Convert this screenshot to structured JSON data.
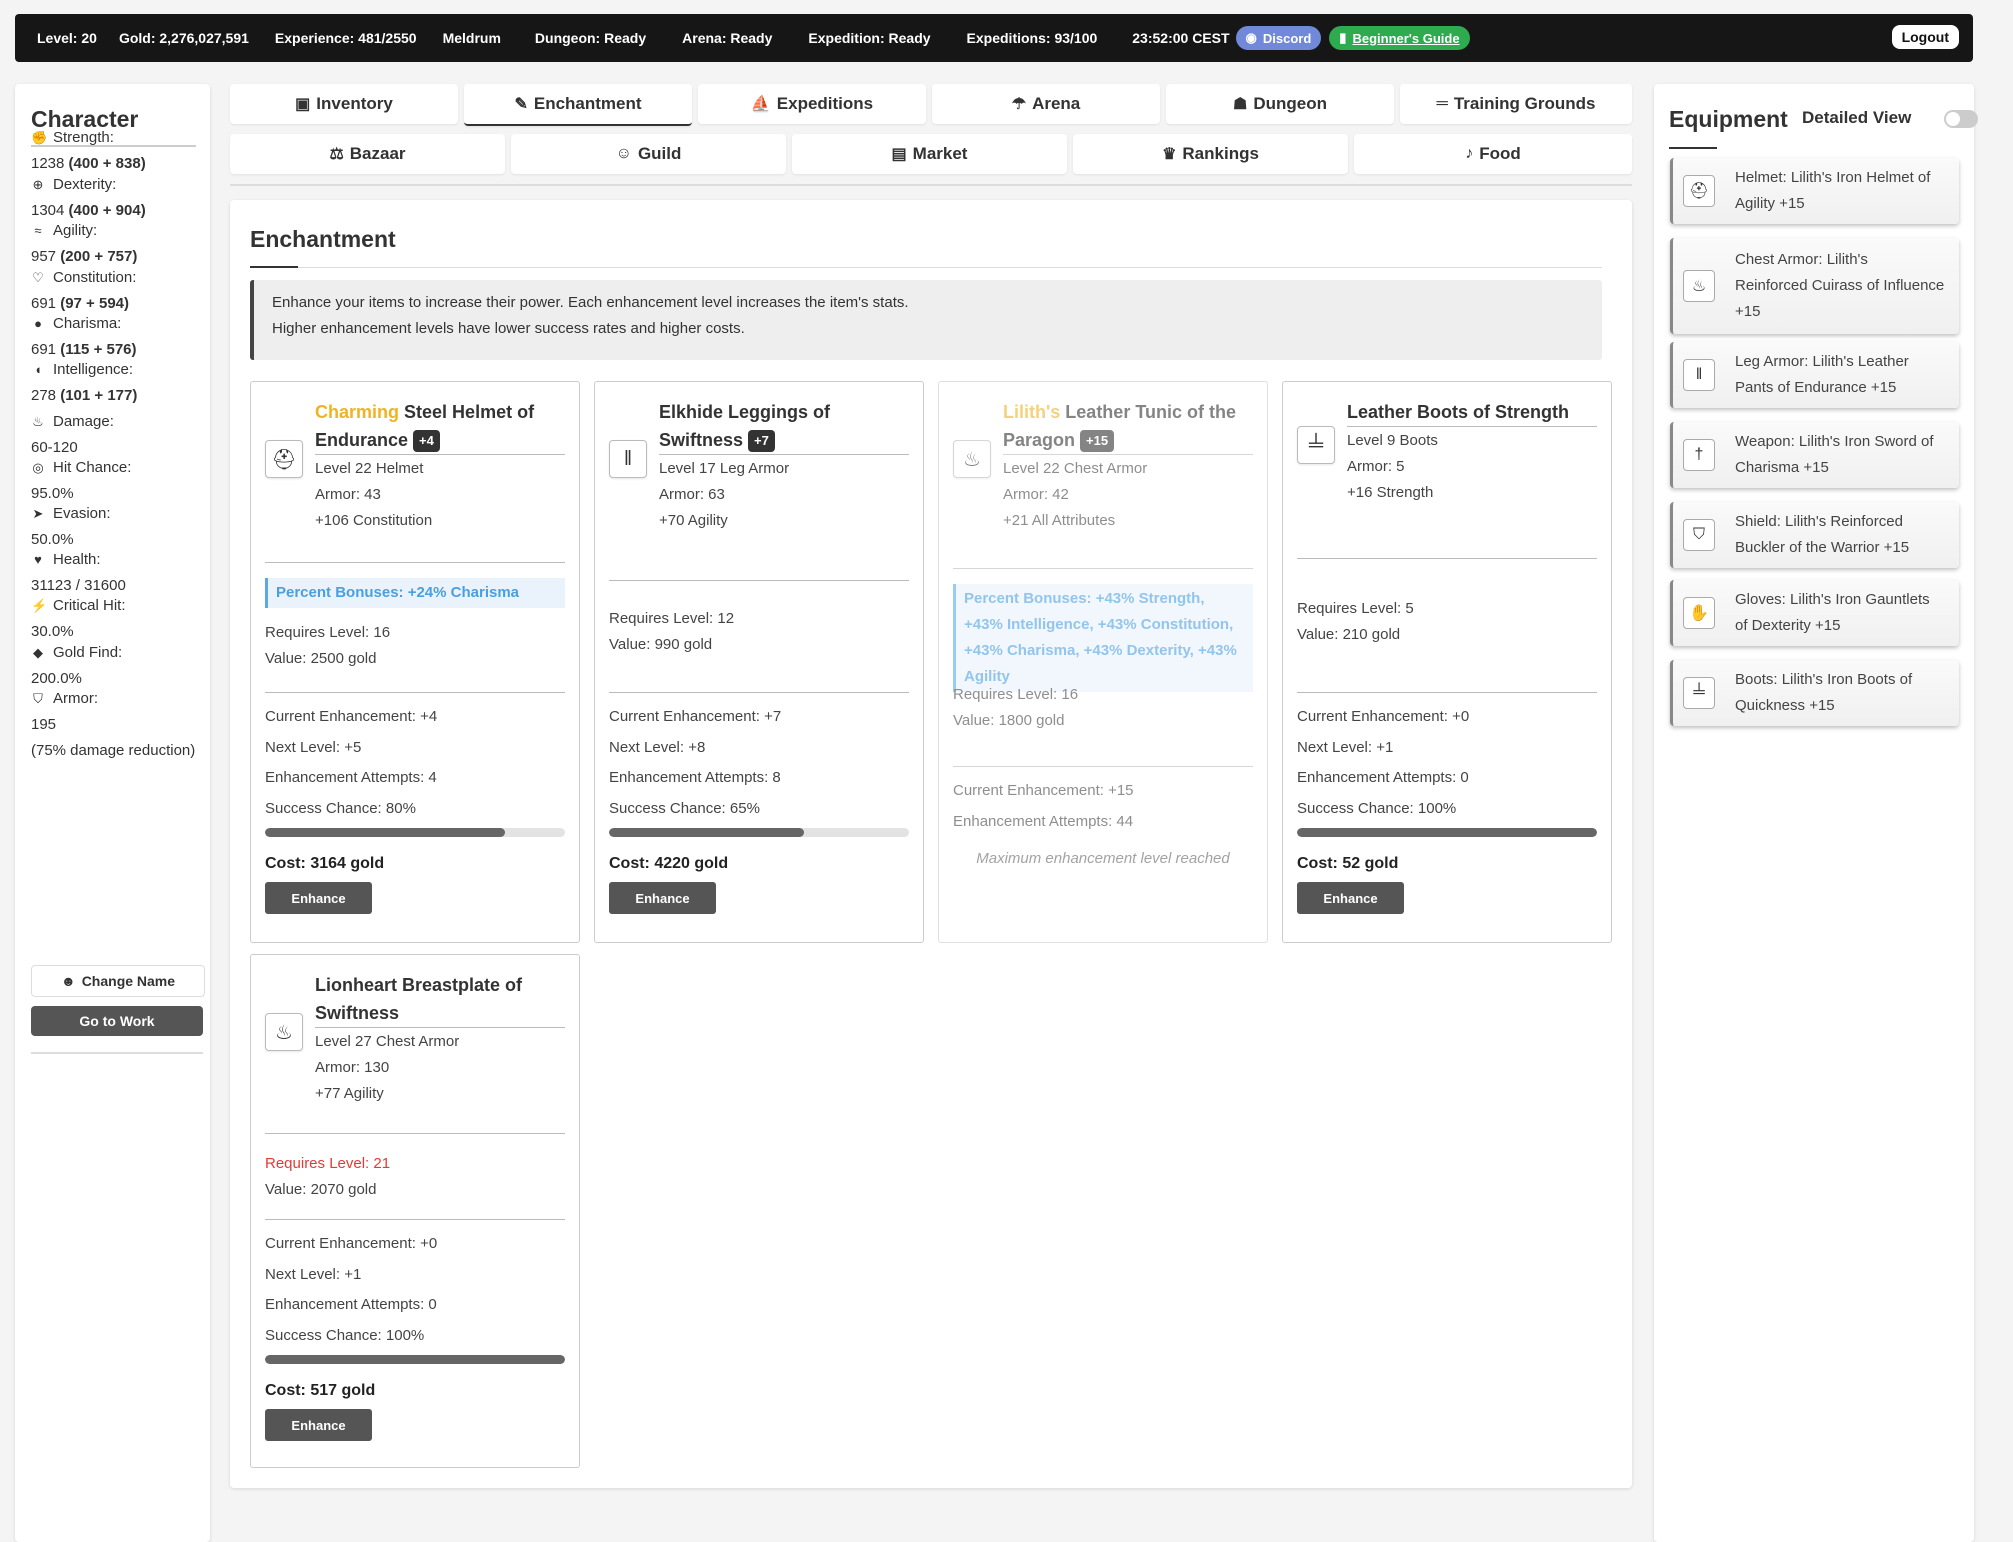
{
  "topbar": {
    "level": "Level: 20",
    "gold": "Gold: 2,276,027,591",
    "experience": "Experience: 481/2550",
    "name": "Meldrum",
    "dungeon": "Dungeon: Ready",
    "arena": "Arena: Ready",
    "expedition": "Expedition: Ready",
    "expeditions": "Expeditions: 93/100",
    "time": "23:52:00 CEST",
    "discord": "Discord",
    "guide": "Beginner's Guide",
    "logout": "Logout"
  },
  "character": {
    "title": "Character",
    "stats": [
      {
        "icon": "fist-icon",
        "label": "Strength:",
        "value": "1238",
        "detail": "(400 + 838)"
      },
      {
        "icon": "crosshair-icon",
        "label": "Dexterity:",
        "value": "1304",
        "detail": "(400 + 904)"
      },
      {
        "icon": "wind-icon",
        "label": "Agility:",
        "value": "957",
        "detail": "(200 + 757)"
      },
      {
        "icon": "heartbeat-icon",
        "label": "Constitution:",
        "value": "691",
        "detail": "(97 + 594)"
      },
      {
        "icon": "speech-icon",
        "label": "Charisma:",
        "value": "691",
        "detail": "(115 + 576)"
      },
      {
        "icon": "brain-icon",
        "label": "Intelligence:",
        "value": "278",
        "detail": "(101 + 177)"
      },
      {
        "icon": "fire-icon",
        "label": "Damage:",
        "value": "60-120",
        "detail": ""
      },
      {
        "icon": "target-icon",
        "label": "Hit Chance:",
        "value": "95.0%",
        "detail": ""
      },
      {
        "icon": "running-icon",
        "label": "Evasion:",
        "value": "50.0%",
        "detail": ""
      },
      {
        "icon": "heart-icon",
        "label": "Health:",
        "value": "31123 / 31600",
        "detail": ""
      },
      {
        "icon": "bolt-icon",
        "label": "Critical Hit:",
        "value": "30.0%",
        "detail": ""
      },
      {
        "icon": "gem-icon",
        "label": "Gold Find:",
        "value": "200.0%",
        "detail": ""
      },
      {
        "icon": "shield-icon",
        "label": "Armor:",
        "value": "195",
        "detail": "",
        "extra": "(75% damage reduction)"
      }
    ],
    "change_name": "Change Name",
    "go_to_work": "Go to Work"
  },
  "tabs_row1": [
    {
      "icon": "box-icon",
      "label": "Inventory"
    },
    {
      "icon": "pen-icon",
      "label": "Enchantment"
    },
    {
      "icon": "ship-icon",
      "label": "Expeditions"
    },
    {
      "icon": "trophy-icon",
      "label": "Arena"
    },
    {
      "icon": "dungeon-icon",
      "label": "Dungeon"
    },
    {
      "icon": "dumbbell-icon",
      "label": "Training Grounds"
    }
  ],
  "tabs_row2": [
    {
      "icon": "scale-icon",
      "label": "Bazaar"
    },
    {
      "icon": "users-icon",
      "label": "Guild"
    },
    {
      "icon": "store-icon",
      "label": "Market"
    },
    {
      "icon": "crown-icon",
      "label": "Rankings"
    },
    {
      "icon": "drumstick-icon",
      "label": "Food"
    }
  ],
  "enchant": {
    "title": "Enchantment",
    "info_line1": "Enhance your items to increase their power. Each enhancement level increases the item's stats.",
    "info_line2": "Higher enhancement levels have lower success rates and higher costs.",
    "cards": [
      {
        "icon": "helmet-icon",
        "prefix": "Charming",
        "name": "Steel Helmet of",
        "name2": "Endurance",
        "badge": "+4",
        "sub1": "Level 22 Helmet",
        "sub2": "Armor: 43",
        "sub3": "+106 Constitution",
        "bonus": "Percent Bonuses: +24% Charisma",
        "req": "Requires Level: 16",
        "value": "Value: 2500 gold",
        "current": "Current Enhancement: +4",
        "next": "Next Level: +5",
        "attempts": "Enhancement Attempts: 4",
        "success": "Success Chance: 80%",
        "success_pct": 80,
        "cost": "Cost: 3164 gold",
        "button": "Enhance"
      },
      {
        "icon": "leggings-icon",
        "prefix": "",
        "name": "Elkhide Leggings of Swiftness",
        "name2": "",
        "badge": "+7",
        "sub1": "Level 17 Leg Armor",
        "sub2": "Armor: 63",
        "sub3": "+70 Agility",
        "req": "Requires Level: 12",
        "value": "Value: 990 gold",
        "current": "Current Enhancement: +7",
        "next": "Next Level: +8",
        "attempts": "Enhancement Attempts: 8",
        "success": "Success Chance: 65%",
        "success_pct": 65,
        "cost": "Cost: 4220 gold",
        "button": "Enhance"
      },
      {
        "icon": "tunic-icon",
        "prefix": "Lilith's",
        "name": "Leather Tunic of the",
        "name2": "Paragon",
        "badge": "+15",
        "sub1": "Level 22 Chest Armor",
        "sub2": "Armor: 42",
        "sub3": "+21 All Attributes",
        "bonus": "Percent Bonuses: +43% Strength, +43% Intelligence, +43% Constitution, +43% Charisma, +43% Dexterity, +43% Agility",
        "req": "Requires Level: 16",
        "value": "Value: 1800 gold",
        "current": "Current Enhancement: +15",
        "attempts": "Enhancement Attempts: 44",
        "max_msg": "Maximum enhancement level reached"
      },
      {
        "icon": "boots-icon",
        "prefix": "",
        "name": "Leather Boots of Strength",
        "name2": "",
        "sub1": "Level 9 Boots",
        "sub2": "Armor: 5",
        "sub3": "+16 Strength",
        "req": "Requires Level: 5",
        "value": "Value: 210 gold",
        "current": "Current Enhancement: +0",
        "next": "Next Level: +1",
        "attempts": "Enhancement Attempts: 0",
        "success": "Success Chance: 100%",
        "success_pct": 100,
        "cost": "Cost: 52 gold",
        "button": "Enhance"
      },
      {
        "icon": "breastplate-icon",
        "prefix": "",
        "name": "Lionheart Breastplate of",
        "name2": "Swiftness",
        "sub1": "Level 27 Chest Armor",
        "sub2": "Armor: 130",
        "sub3": "+77 Agility",
        "req": "Requires Level: 21",
        "value": "Value: 2070 gold",
        "current": "Current Enhancement: +0",
        "next": "Next Level: +1",
        "attempts": "Enhancement Attempts: 0",
        "success": "Success Chance: 100%",
        "success_pct": 100,
        "cost": "Cost: 517 gold",
        "button": "Enhance"
      }
    ]
  },
  "equipment": {
    "title": "Equipment",
    "detailed_view": "Detailed View",
    "items": [
      {
        "icon": "helmet-icon",
        "l1": "Helmet: Lilith's Iron Helmet of",
        "l2": "Agility +15",
        "l3": ""
      },
      {
        "icon": "tunic-icon",
        "l1": "Chest Armor: Lilith's",
        "l2": "Reinforced Cuirass of Influence",
        "l3": "+15"
      },
      {
        "icon": "leggings-icon",
        "l1": "Leg Armor: Lilith's Leather",
        "l2": "Pants of Endurance +15",
        "l3": ""
      },
      {
        "icon": "sword-icon",
        "l1": "Weapon: Lilith's Iron Sword of",
        "l2": "Charisma +15",
        "l3": ""
      },
      {
        "icon": "shield-icon",
        "l1": "Shield: Lilith's Reinforced",
        "l2": "Buckler of the Warrior +15",
        "l3": ""
      },
      {
        "icon": "gauntlets-icon",
        "l1": "Gloves: Lilith's Iron Gauntlets",
        "l2": "of Dexterity +15",
        "l3": ""
      },
      {
        "icon": "boots-icon",
        "l1": "Boots: Lilith's Iron Boots of",
        "l2": "Quickness +15",
        "l3": ""
      }
    ]
  }
}
